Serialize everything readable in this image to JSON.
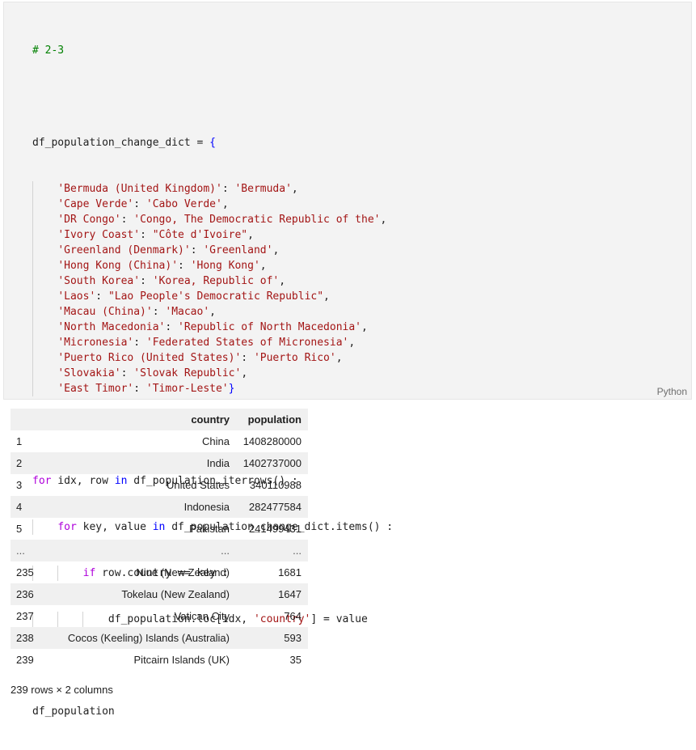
{
  "cell": {
    "language_label": "Python",
    "code": {
      "comment": "# 2-3",
      "dict_name": "df_population_change_dict",
      "entries": [
        {
          "key": "'Bermuda (United Kingdom)'",
          "value": "'Bermuda'"
        },
        {
          "key": "'Cape Verde'",
          "value": "'Cabo Verde'"
        },
        {
          "key": "'DR Congo'",
          "value": "'Congo, The Democratic Republic of the'"
        },
        {
          "key": "'Ivory Coast'",
          "value": "\"Côte d'Ivoire\""
        },
        {
          "key": "'Greenland (Denmark)'",
          "value": "'Greenland'"
        },
        {
          "key": "'Hong Kong (China)'",
          "value": "'Hong Kong'"
        },
        {
          "key": "'South Korea'",
          "value": "'Korea, Republic of'"
        },
        {
          "key": "'Laos'",
          "value": "\"Lao People's Democratic Republic\""
        },
        {
          "key": "'Macau (China)'",
          "value": "'Macao'"
        },
        {
          "key": "'North Macedonia'",
          "value": "'Republic of North Macedonia'"
        },
        {
          "key": "'Micronesia'",
          "value": "'Federated States of Micronesia'"
        },
        {
          "key": "'Puerto Rico (United States)'",
          "value": "'Puerto Rico'"
        },
        {
          "key": "'Slovakia'",
          "value": "'Slovak Republic'"
        },
        {
          "key": "'East Timor'",
          "value": "'Timor-Leste'"
        }
      ],
      "loop1_a": " idx, row ",
      "loop1_b": " df_population.iterrows() :",
      "loop2_a": " key, value ",
      "loop2_b": " df_population_change_dict.items() :",
      "if_cond": " row.country == key :",
      "assign_a": "df_population.loc[idx, ",
      "assign_str": "'country'",
      "assign_b": "] = value",
      "last_line": "df_population"
    }
  },
  "table": {
    "columns": [
      "",
      "country",
      "population"
    ],
    "rows": [
      {
        "idx": "1",
        "country": "China",
        "population": "1408280000"
      },
      {
        "idx": "2",
        "country": "India",
        "population": "1402737000"
      },
      {
        "idx": "3",
        "country": "United States",
        "population": "340110988"
      },
      {
        "idx": "4",
        "country": "Indonesia",
        "population": "282477584"
      },
      {
        "idx": "5",
        "country": "Pakistan",
        "population": "241499431"
      },
      {
        "idx": "...",
        "country": "...",
        "population": "..."
      },
      {
        "idx": "235",
        "country": "Niue (New Zealand)",
        "population": "1681"
      },
      {
        "idx": "236",
        "country": "Tokelau (New Zealand)",
        "population": "1647"
      },
      {
        "idx": "237",
        "country": "Vatican City",
        "population": "764"
      },
      {
        "idx": "238",
        "country": "Cocos (Keeling) Islands (Australia)",
        "population": "593"
      },
      {
        "idx": "239",
        "country": "Pitcairn Islands (UK)",
        "population": "35"
      }
    ],
    "summary": "239 rows × 2 columns"
  }
}
